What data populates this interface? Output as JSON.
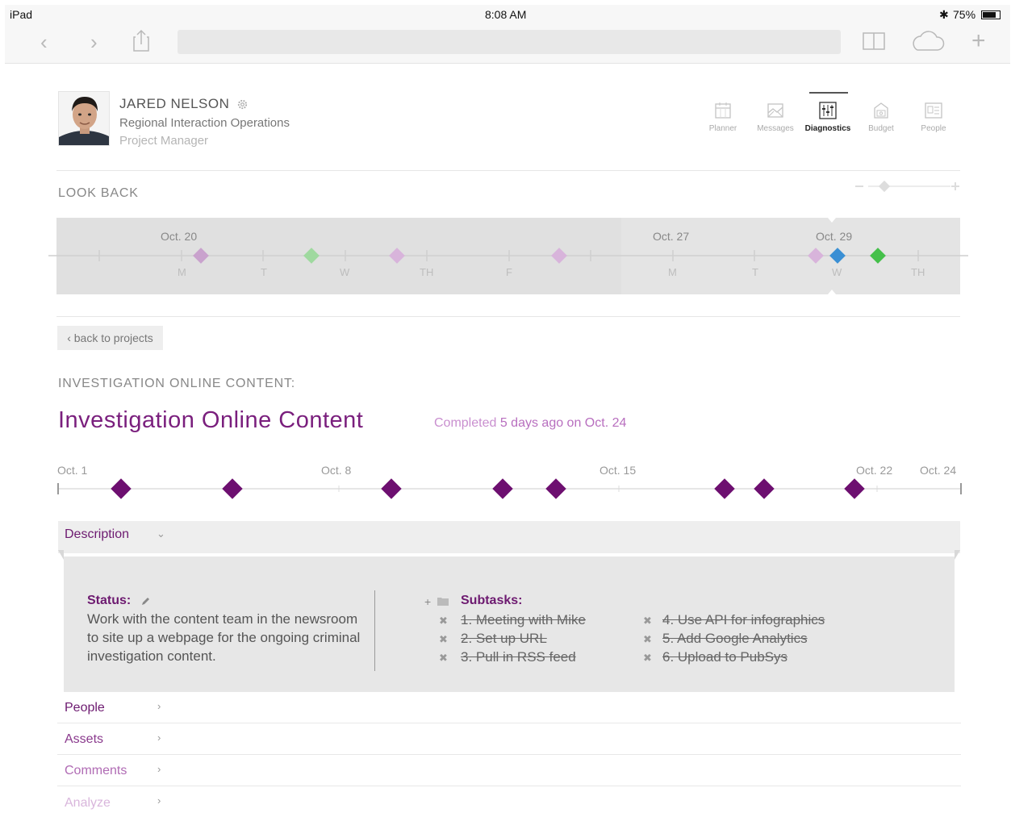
{
  "status_bar": {
    "device": "iPad",
    "time": "8:08 AM",
    "battery": "75%"
  },
  "browser": {
    "back_icon": "chevron-left-icon",
    "forward_icon": "chevron-right-icon",
    "share_icon": "share-icon",
    "bookmarks_icon": "book-icon",
    "cloud_icon": "cloud-icon",
    "add_icon": "plus-icon"
  },
  "profile": {
    "name": "JARED NELSON",
    "department": "Regional Interaction Operations",
    "title": "Project Manager"
  },
  "app_nav": [
    {
      "label": "Planner",
      "icon": "calendar-icon",
      "active": false
    },
    {
      "label": "Messages",
      "icon": "envelope-icon",
      "active": false
    },
    {
      "label": "Diagnostics",
      "icon": "sliders-icon",
      "active": true
    },
    {
      "label": "Budget",
      "icon": "safe-icon",
      "active": false
    },
    {
      "label": "People",
      "icon": "id-card-icon",
      "active": false
    }
  ],
  "look_back": {
    "label": "LOOK BACK",
    "dates": [
      "Oct. 20",
      "Oct. 27",
      "Oct. 29"
    ],
    "days": [
      "M",
      "T",
      "W",
      "TH",
      "F",
      "M",
      "T",
      "W",
      "TH"
    ]
  },
  "back_button": "back to projects",
  "section_heading": "INVESTIGATION ONLINE CONTENT:",
  "project": {
    "title": "Investigation Online Content",
    "completed_prefix": "Completed",
    "completed_detail": "5 days ago on Oct. 24"
  },
  "project_timeline": {
    "dates": [
      "Oct. 1",
      "Oct. 8",
      "Oct. 15",
      "Oct. 22",
      "Oct. 24"
    ]
  },
  "description": {
    "label": "Description",
    "status_label": "Status:",
    "status_text": "Work with the content team in the newsroom to site up a webpage for the ongoing criminal investigation content.",
    "subtasks_label": "Subtasks:",
    "subtasks": [
      "1. Meeting with Mike",
      "2. Set up URL",
      "3. Pull in RSS feed",
      "4. Use API for infographics",
      "5. Add Google Analytics",
      "6. Upload to PubSys"
    ]
  },
  "accordion": [
    "People",
    "Assets",
    "Comments",
    "Analyze"
  ],
  "colors": {
    "accent": "#7a1f7d",
    "diamond_dark": "#6d0f70",
    "diamond_light": "#d8b4db",
    "diamond_green": "#45c04a",
    "diamond_blue": "#3a8fd4"
  }
}
